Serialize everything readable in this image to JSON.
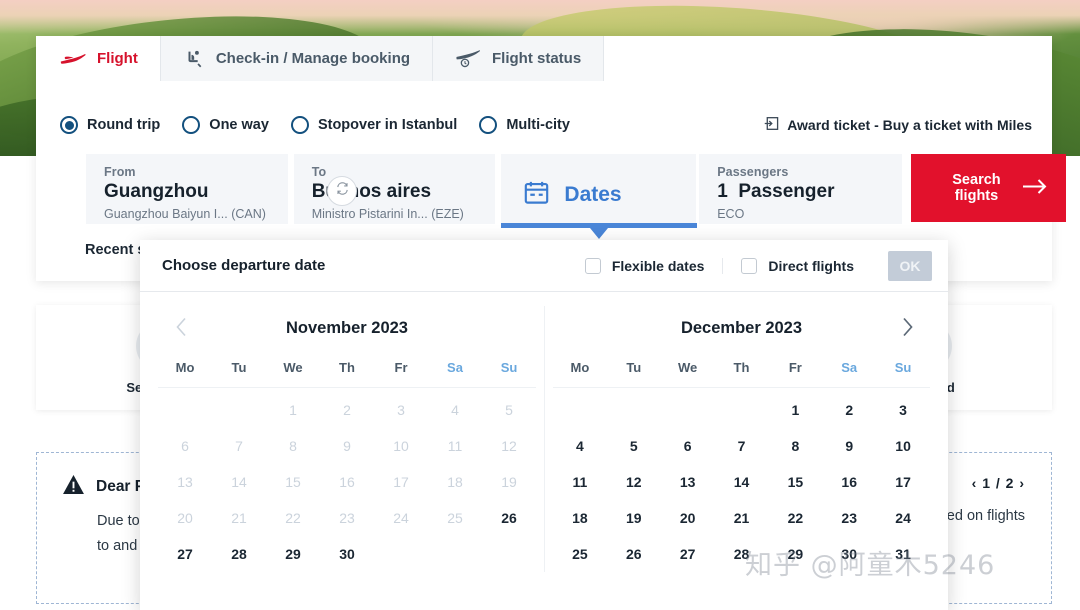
{
  "tabs": [
    {
      "label": "Flight",
      "icon": "plane-icon",
      "active": true
    },
    {
      "label": "Check-in / Manage booking",
      "icon": "seat-icon",
      "active": false
    },
    {
      "label": "Flight status",
      "icon": "flight-status-icon",
      "active": false
    }
  ],
  "trip_types": [
    {
      "label": "Round trip",
      "selected": true
    },
    {
      "label": "One way",
      "selected": false
    },
    {
      "label": "Stopover in Istanbul",
      "selected": false
    },
    {
      "label": "Multi-city",
      "selected": false
    }
  ],
  "award": {
    "label": "Award ticket - Buy a ticket with Miles",
    "icon": "enter-arrow-icon"
  },
  "search_form": {
    "from": {
      "label": "From",
      "city": "Guangzhou",
      "airport": "Guangzhou Baiyun I...",
      "code": "(CAN)"
    },
    "to": {
      "label": "To",
      "city": "Buenos aires",
      "airport": "Ministro Pistarini In...",
      "code": "(EZE)"
    },
    "swap_icon": "swap-icon",
    "dates": {
      "label": "Dates",
      "icon": "calendar-icon",
      "active": true
    },
    "passengers": {
      "label": "Passengers",
      "count": "1",
      "noun": "Passenger",
      "cabin": "ECO"
    },
    "search_button": {
      "label": "Search flights",
      "icon": "arrow-right-icon"
    }
  },
  "recent_search_label": "Recent sear",
  "services": [
    {
      "label": "Seat Select",
      "icon": "seat-select-icon"
    },
    {
      "label": "Gift Card",
      "icon": "gift-card-icon"
    }
  ],
  "notice": {
    "icon": "warning-icon",
    "title": "Dear Pa",
    "line1": "Due to e",
    "line2": "to and fl",
    "right_text": "ed on flights",
    "pager": "‹ 1 / 2 ›"
  },
  "calendar": {
    "title": "Choose departure date",
    "flexible_dates": {
      "label": "Flexible dates",
      "checked": false
    },
    "direct_flights": {
      "label": "Direct flights",
      "checked": false
    },
    "ok_button": {
      "label": "OK",
      "disabled": true
    },
    "prev_arrow": {
      "icon": "chevron-left-icon",
      "enabled": false
    },
    "next_arrow": {
      "icon": "chevron-right-icon",
      "enabled": true
    },
    "weekdays": [
      "Mo",
      "Tu",
      "We",
      "Th",
      "Fr",
      "Sa",
      "Su"
    ],
    "months": [
      {
        "name": "November 2023",
        "lead_blanks": 2,
        "days": [
          {
            "n": "1",
            "enabled": false
          },
          {
            "n": "2",
            "enabled": false
          },
          {
            "n": "3",
            "enabled": false
          },
          {
            "n": "4",
            "enabled": false
          },
          {
            "n": "5",
            "enabled": false
          },
          {
            "n": "6",
            "enabled": false
          },
          {
            "n": "7",
            "enabled": false
          },
          {
            "n": "8",
            "enabled": false
          },
          {
            "n": "9",
            "enabled": false
          },
          {
            "n": "10",
            "enabled": false
          },
          {
            "n": "11",
            "enabled": false
          },
          {
            "n": "12",
            "enabled": false
          },
          {
            "n": "13",
            "enabled": false
          },
          {
            "n": "14",
            "enabled": false
          },
          {
            "n": "15",
            "enabled": false
          },
          {
            "n": "16",
            "enabled": false
          },
          {
            "n": "17",
            "enabled": false
          },
          {
            "n": "18",
            "enabled": false
          },
          {
            "n": "19",
            "enabled": false
          },
          {
            "n": "20",
            "enabled": false
          },
          {
            "n": "21",
            "enabled": false
          },
          {
            "n": "22",
            "enabled": false
          },
          {
            "n": "23",
            "enabled": false
          },
          {
            "n": "24",
            "enabled": false
          },
          {
            "n": "25",
            "enabled": false
          },
          {
            "n": "26",
            "enabled": true
          },
          {
            "n": "27",
            "enabled": true
          },
          {
            "n": "28",
            "enabled": true
          },
          {
            "n": "29",
            "enabled": true
          },
          {
            "n": "30",
            "enabled": true
          }
        ]
      },
      {
        "name": "December 2023",
        "lead_blanks": 4,
        "days": [
          {
            "n": "1",
            "enabled": true
          },
          {
            "n": "2",
            "enabled": true
          },
          {
            "n": "3",
            "enabled": true
          },
          {
            "n": "4",
            "enabled": true
          },
          {
            "n": "5",
            "enabled": true
          },
          {
            "n": "6",
            "enabled": true
          },
          {
            "n": "7",
            "enabled": true
          },
          {
            "n": "8",
            "enabled": true
          },
          {
            "n": "9",
            "enabled": true
          },
          {
            "n": "10",
            "enabled": true
          },
          {
            "n": "11",
            "enabled": true
          },
          {
            "n": "12",
            "enabled": true
          },
          {
            "n": "13",
            "enabled": true
          },
          {
            "n": "14",
            "enabled": true
          },
          {
            "n": "15",
            "enabled": true
          },
          {
            "n": "16",
            "enabled": true
          },
          {
            "n": "17",
            "enabled": true
          },
          {
            "n": "18",
            "enabled": true
          },
          {
            "n": "19",
            "enabled": true
          },
          {
            "n": "20",
            "enabled": true
          },
          {
            "n": "21",
            "enabled": true
          },
          {
            "n": "22",
            "enabled": true
          },
          {
            "n": "23",
            "enabled": true
          },
          {
            "n": "24",
            "enabled": true
          },
          {
            "n": "25",
            "enabled": true
          },
          {
            "n": "26",
            "enabled": true
          },
          {
            "n": "27",
            "enabled": true
          },
          {
            "n": "28",
            "enabled": true
          },
          {
            "n": "29",
            "enabled": true
          },
          {
            "n": "30",
            "enabled": true
          },
          {
            "n": "31",
            "enabled": true
          }
        ]
      }
    ]
  },
  "watermark": "知乎 @阿童木5246",
  "colors": {
    "brand_red": "#e2112c",
    "accent_blue": "#3a7bd0",
    "navy": "#13507e",
    "text_dark": "#16212c",
    "muted": "#6b7785",
    "disabled_day": "#cbd3dc"
  }
}
